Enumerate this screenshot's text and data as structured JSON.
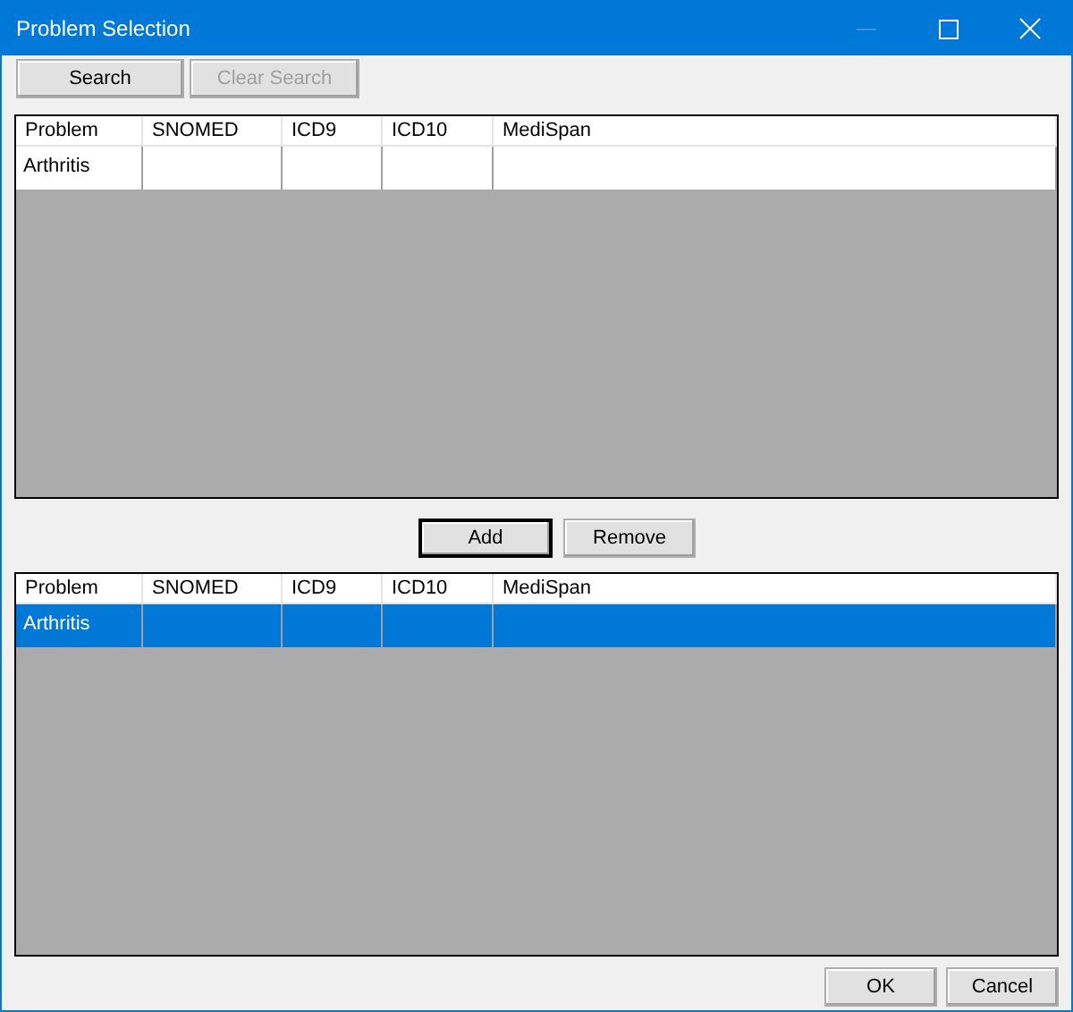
{
  "window": {
    "title": "Problem Selection",
    "minimize_disabled": true
  },
  "search_buttons": [
    {
      "label": "Search",
      "disabled": false
    },
    {
      "label": "Clear Search",
      "disabled": true
    }
  ],
  "results_grid": {
    "columns": [
      "Problem",
      "SNOMED",
      "ICD9",
      "ICD10",
      "MediSpan"
    ],
    "rows": [
      {
        "problem": "Arthritis",
        "selected": false
      }
    ]
  },
  "move_buttons": [
    {
      "label": "Add",
      "default": true
    },
    {
      "label": "Remove",
      "default": false
    }
  ],
  "selected_grid": {
    "columns": [
      "Problem",
      "SNOMED",
      "ICD9",
      "ICD10",
      "MediSpan"
    ],
    "rows": [
      {
        "problem": "Arthritis",
        "selected": true
      }
    ]
  },
  "dialog_buttons": [
    {
      "label": "OK"
    },
    {
      "label": "Cancel"
    }
  ]
}
